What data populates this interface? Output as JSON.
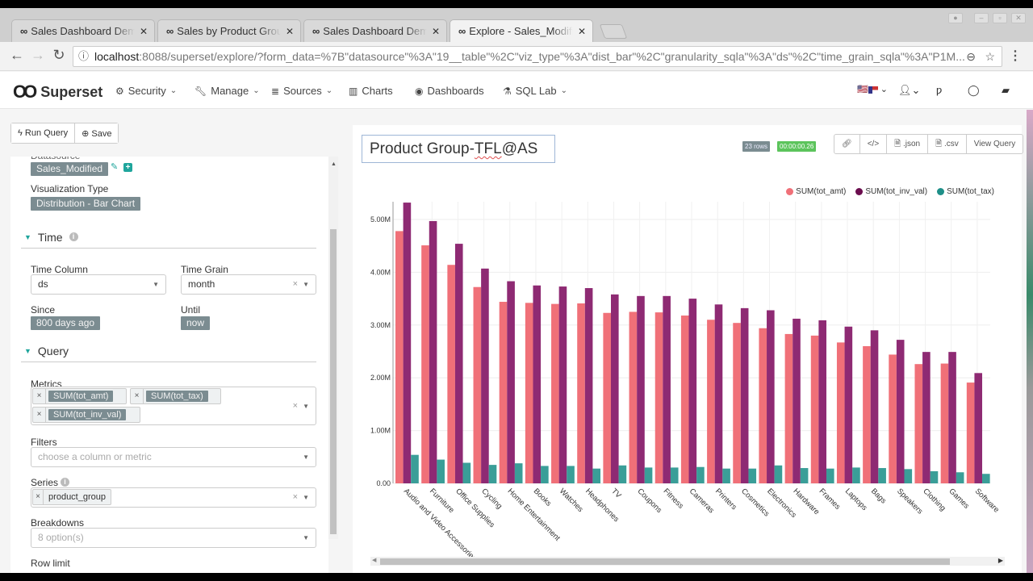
{
  "browser": {
    "tabs": [
      {
        "title": "Sales Dashboard Demo",
        "active": false
      },
      {
        "title": "Sales by Product Group",
        "active": false
      },
      {
        "title": "Sales Dashboard Demo",
        "active": false
      },
      {
        "title": "Explore - Sales_Modified",
        "active": true
      }
    ],
    "url_host": "localhost",
    "url_rest": ":8088/superset/explore/?form_data=%7B\"datasource\"%3A\"19__table\"%2C\"viz_type\"%3A\"dist_bar\"%2C\"granularity_sqla\"%3A\"ds\"%2C\"time_grain_sqla\"%3A\"P1M..."
  },
  "navbar": {
    "brand": "Superset",
    "items": [
      {
        "label": "Security",
        "icon": "cogs-icon",
        "dropdown": true
      },
      {
        "label": "Manage",
        "icon": "wrench-icon",
        "dropdown": true
      },
      {
        "label": "Sources",
        "icon": "database-icon",
        "dropdown": true
      },
      {
        "label": "Charts",
        "icon": "bar-chart-icon",
        "dropdown": false
      },
      {
        "label": "Dashboards",
        "icon": "dashboard-icon",
        "dropdown": false
      },
      {
        "label": "SQL Lab",
        "icon": "flask-icon",
        "dropdown": true
      }
    ]
  },
  "actions": {
    "run_query": "Run Query",
    "save": "Save"
  },
  "controls": {
    "datasource_label": "Datasource",
    "datasource": "Sales_Modified",
    "viz_type_label": "Visualization Type",
    "viz_type": "Distribution - Bar Chart",
    "time_section": "Time",
    "time_column_label": "Time Column",
    "time_column": "ds",
    "time_grain_label": "Time Grain",
    "time_grain": "month",
    "since_label": "Since",
    "since": "800 days ago",
    "until_label": "Until",
    "until": "now",
    "query_section": "Query",
    "metrics_label": "Metrics",
    "metrics": [
      "SUM(tot_amt)",
      "SUM(tot_tax)",
      "SUM(tot_inv_val)"
    ],
    "filters_label": "Filters",
    "filters_placeholder": "choose a column or metric",
    "series_label": "Series",
    "series": "product_group",
    "breakdowns_label": "Breakdowns",
    "breakdowns_placeholder": "8 option(s)",
    "row_limit_label": "Row limit"
  },
  "slice": {
    "name_prefix": "Product Group-",
    "name_underlined": "TFL",
    "name_suffix": "@AS",
    "rows_badge": "23 rows",
    "timer_badge": "00:00:00.26",
    "buttons": {
      "link": "",
      "embed": "</>",
      "json": ".json",
      "csv": ".csv",
      "view_query": "View Query"
    }
  },
  "colors": {
    "amt": "#f07078",
    "inv": "#8e2a73",
    "tax": "#3a9e98",
    "accent": "#1fa59c",
    "timer": "#5cc45c"
  },
  "chart_data": {
    "type": "bar",
    "title": "",
    "xlabel": "",
    "ylabel": "",
    "ylim": [
      0,
      5400000
    ],
    "yticks": [
      0,
      1000000,
      2000000,
      3000000,
      4000000,
      5000000
    ],
    "ytick_labels": [
      "0.00",
      "1.00M",
      "2.00M",
      "3.00M",
      "4.00M",
      "5.00M"
    ],
    "grid": true,
    "legend_position": "top-right",
    "categories": [
      "Audio and Video Accessories",
      "Furniture",
      "Office Supplies",
      "Cycling",
      "Home Entertainment",
      "Books",
      "Watches",
      "Headphones",
      "TV",
      "Coupons",
      "Fitness",
      "Cameras",
      "Printers",
      "Cosmetics",
      "Electronics",
      "Hardware",
      "Frames",
      "Laptops",
      "Bags",
      "Speakers",
      "Clothing",
      "Games",
      "Software"
    ],
    "series": [
      {
        "name": "SUM(tot_amt)",
        "color": "#f07078",
        "values": [
          4780000,
          4510000,
          4140000,
          3720000,
          3440000,
          3420000,
          3400000,
          3410000,
          3230000,
          3250000,
          3240000,
          3180000,
          3100000,
          3040000,
          2940000,
          2830000,
          2800000,
          2670000,
          2600000,
          2440000,
          2260000,
          2270000,
          1910000
        ]
      },
      {
        "name": "SUM(tot_inv_val)",
        "color": "#8e2a73",
        "values": [
          5320000,
          4970000,
          4540000,
          4070000,
          3830000,
          3750000,
          3730000,
          3700000,
          3580000,
          3550000,
          3550000,
          3500000,
          3390000,
          3320000,
          3280000,
          3120000,
          3090000,
          2970000,
          2900000,
          2720000,
          2490000,
          2490000,
          2090000
        ]
      },
      {
        "name": "SUM(tot_tax)",
        "color": "#3a9e98",
        "values": [
          540000,
          450000,
          390000,
          350000,
          380000,
          330000,
          330000,
          280000,
          340000,
          300000,
          300000,
          310000,
          280000,
          280000,
          340000,
          290000,
          280000,
          300000,
          290000,
          270000,
          230000,
          210000,
          180000
        ]
      }
    ]
  }
}
